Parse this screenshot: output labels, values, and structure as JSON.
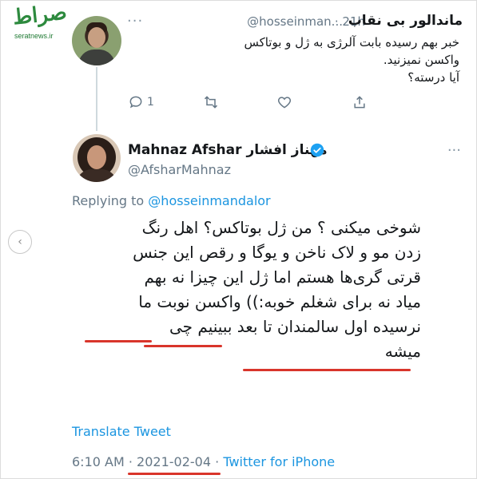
{
  "watermark": {
    "logo_text": "صراط",
    "url": "seratnews.ir"
  },
  "tweet_parent": {
    "display_name": "ماندالور بی نقاب",
    "handle": "@hosseinman...",
    "time": "· 21h",
    "text_lines": [
      "خبر بهم رسیده بابت آلرژی به ژل و بوتاکس",
      "واکسن نمیزنید.",
      "آیا درسته؟"
    ],
    "actions": {
      "reply_icon": "reply-icon",
      "reply_count": "1",
      "retweet_icon": "retweet-icon",
      "like_icon": "heart-icon",
      "share_icon": "share-icon"
    }
  },
  "tweet_main": {
    "display_name_en": "Mahnaz Afshar",
    "display_name_fa": "مهناز افشار",
    "handle": "@AfsharMahnaz",
    "verified_icon": "verified-badge-icon",
    "replying_prefix": "Replying to",
    "replying_to": "@hosseinmandalor",
    "text_lines": [
      "شوخی میکنی ؟ من ژل بوتاکس؟ اهل رنگ",
      "زدن مو و لاک ناخن و یوگا و رقص این جنس",
      "قرتی گری‌ها هستم اما ژل این چیزا نه بهم",
      "میاد نه برای شغلم خوبه:)) واکسن نوبت ما",
      "نرسیده اول سالمندان تا بعد ببینیم چی",
      "میشه"
    ],
    "translate_label": "Translate Tweet",
    "time": "6:10 AM",
    "separator": "·",
    "date": "2021-02-04",
    "source": "Twitter for iPhone"
  },
  "colors": {
    "accent_blue": "#1b95e0",
    "underline_red": "#d9352b",
    "muted_gray": "#657786"
  }
}
